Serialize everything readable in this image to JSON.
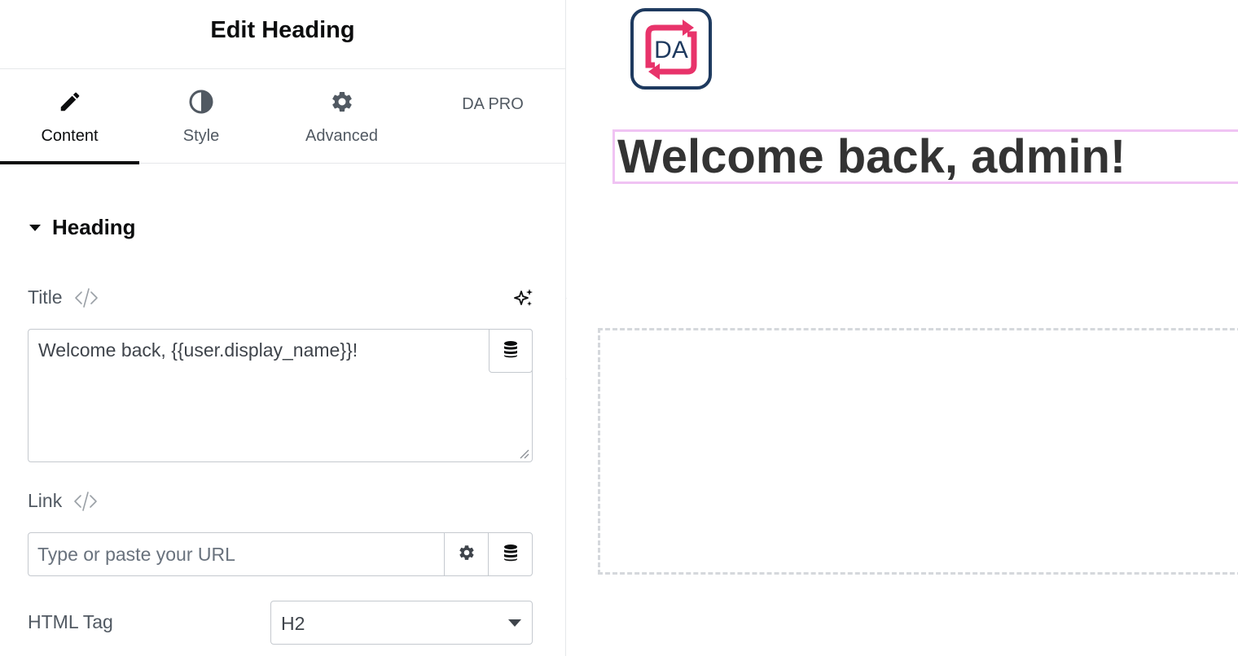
{
  "panel": {
    "title": "Edit Heading",
    "tabs": [
      {
        "label": "Content",
        "icon": "pencil-icon",
        "active": true
      },
      {
        "label": "Style",
        "icon": "half-circle-icon",
        "active": false
      },
      {
        "label": "Advanced",
        "icon": "gear-icon",
        "active": false
      },
      {
        "label": "DA PRO",
        "icon": "",
        "active": false
      }
    ],
    "section": {
      "title": "Heading",
      "expanded": true
    },
    "title_control": {
      "label": "Title",
      "value": "Welcome back, {{user.display_name}}!"
    },
    "link_control": {
      "label": "Link",
      "placeholder": "Type or paste your URL"
    },
    "html_tag_control": {
      "label": "HTML Tag",
      "value": "H2"
    }
  },
  "preview": {
    "heading": "Welcome back, admin!",
    "logo": {
      "text": "DA",
      "frame_color": "#1e3a5f",
      "arrow_color": "#e8336a"
    }
  },
  "colors": {
    "accent_dark": "#0c0d0e",
    "selection_outline": "#f0c3f3",
    "heading_text": "#333333"
  }
}
